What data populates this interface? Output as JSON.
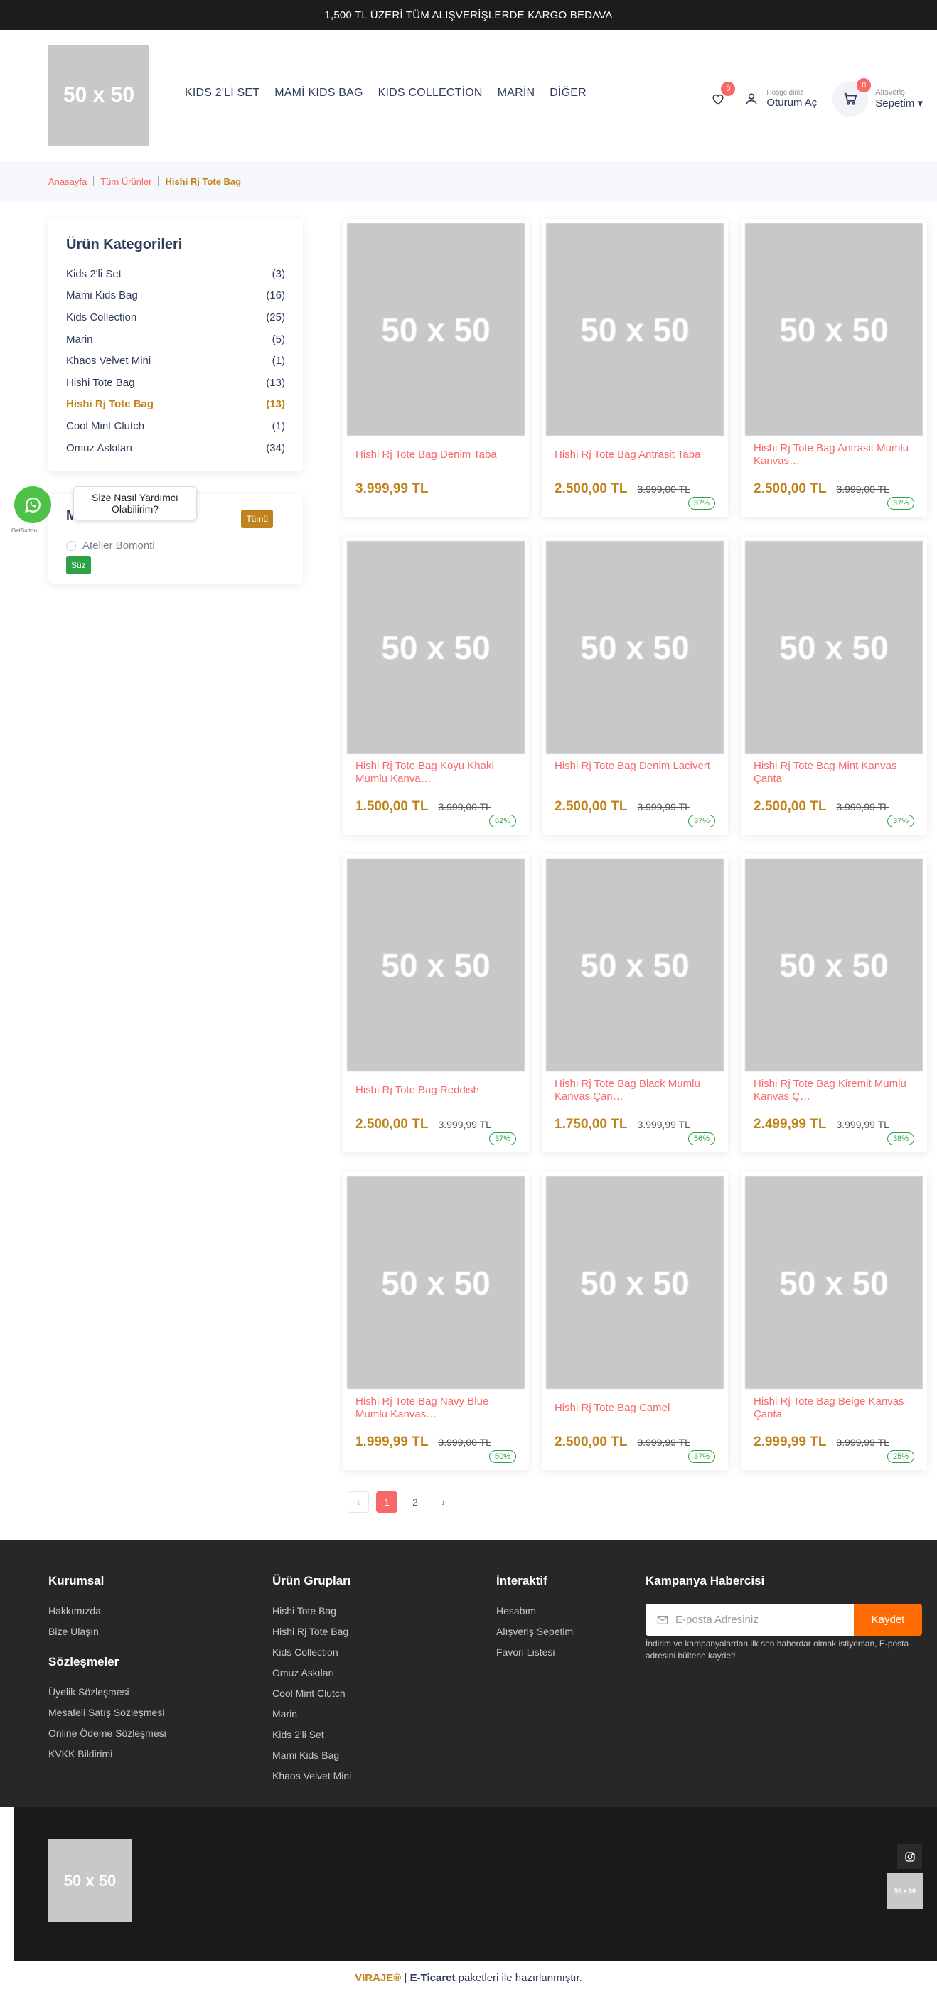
{
  "topbar": {
    "text": "1,500 TL ÜZERİ TÜM ALIŞVERİŞLERDE KARGO BEDAVA"
  },
  "header": {
    "logo": "50 x 50",
    "nav": [
      "KIDS 2'Lİ SET",
      "MAMİ KIDS BAG",
      "KIDS COLLECTİON",
      "MARİN",
      "DİĞER"
    ],
    "wishlist_count": "0",
    "account": {
      "greeting": "Hoşgeldiniz",
      "action": "Oturum Aç"
    },
    "cart": {
      "count": "0",
      "label_small": "Alışveriş",
      "label_big": "Sepetim ▾"
    }
  },
  "breadcrumb": {
    "items": [
      "Anasayfa",
      "Tüm Ürünler"
    ],
    "current": "Hishi Rj Tote Bag"
  },
  "sidebar": {
    "categories_title": "Ürün Kategorileri",
    "categories": [
      {
        "name": "Kids 2'li Set",
        "count": "(3)"
      },
      {
        "name": "Mami Kids Bag",
        "count": "(16)"
      },
      {
        "name": "Kids Collection",
        "count": "(25)"
      },
      {
        "name": "Marin",
        "count": "(5)"
      },
      {
        "name": "Khaos Velvet Mini",
        "count": "(1)"
      },
      {
        "name": "Hishi Tote Bag",
        "count": "(13)"
      },
      {
        "name": "Hishi Rj Tote Bag",
        "count": "(13)"
      },
      {
        "name": "Cool Mint Clutch",
        "count": "(1)"
      },
      {
        "name": "Omuz Askıları",
        "count": "(34)"
      }
    ],
    "brand_title": "Ma",
    "brand_all": "Tümü",
    "brand_option": "Atelier Bomonti",
    "filter_button": "Süz"
  },
  "whatsapp": {
    "tooltip": "Size Nasıl Yardımcı Olabilirim?",
    "getbutton": "GetButton"
  },
  "products": [
    {
      "img": "50 x 50",
      "name": "Hishi Rj Tote Bag Denim Taba",
      "price": "3.999,99 TL",
      "old": "",
      "discount": ""
    },
    {
      "img": "50 x 50",
      "name": "Hishi Rj Tote Bag Antrasit Taba",
      "price": "2.500,00 TL",
      "old": "3.999,00 TL",
      "discount": "37%"
    },
    {
      "img": "50 x 50",
      "name": "Hishi Rj Tote Bag Antrasit Mumlu Kanvas…",
      "price": "2.500,00 TL",
      "old": "3.999,00 TL",
      "discount": "37%"
    },
    {
      "img": "50 x 50",
      "name": "Hishi Rj Tote Bag Koyu Khaki Mumlu Kanva…",
      "price": "1.500,00 TL",
      "old": "3.999,00 TL",
      "discount": "62%"
    },
    {
      "img": "50 x 50",
      "name": "Hishi Rj Tote Bag Denim Lacivert",
      "price": "2.500,00 TL",
      "old": "3.999,99 TL",
      "discount": "37%"
    },
    {
      "img": "50 x 50",
      "name": "Hishi Rj Tote Bag Mint Kanvas Çanta",
      "price": "2.500,00 TL",
      "old": "3.999,99 TL",
      "discount": "37%"
    },
    {
      "img": "50 x 50",
      "name": "Hishi Rj Tote Bag Reddish",
      "price": "2.500,00 TL",
      "old": "3.999,99 TL",
      "discount": "37%"
    },
    {
      "img": "50 x 50",
      "name": "Hishi Rj Tote Bag Black Mumlu Kanvas Çan…",
      "price": "1.750,00 TL",
      "old": "3.999,99 TL",
      "discount": "56%"
    },
    {
      "img": "50 x 50",
      "name": "Hishi Rj Tote Bag Kiremit Mumlu Kanvas Ç…",
      "price": "2.499,99 TL",
      "old": "3.999,99 TL",
      "discount": "38%"
    },
    {
      "img": "50 x 50",
      "name": "Hishi Rj Tote Bag Navy Blue Mumlu Kanvas…",
      "price": "1.999,99 TL",
      "old": "3.999,00 TL",
      "discount": "50%"
    },
    {
      "img": "50 x 50",
      "name": "Hishi Rj Tote Bag Camel",
      "price": "2.500,00 TL",
      "old": "3.999,99 TL",
      "discount": "37%"
    },
    {
      "img": "50 x 50",
      "name": "Hishi Rj Tote Bag Beige Kanvas Çanta",
      "price": "2.999,99 TL",
      "old": "3.999,99 TL",
      "discount": "25%"
    }
  ],
  "pagination": {
    "prev": "‹",
    "pages": [
      "1",
      "2"
    ],
    "next": "›"
  },
  "footer": {
    "kurumsal": {
      "title": "Kurumsal",
      "links": [
        "Hakkımızda",
        "Bize Ulaşın"
      ]
    },
    "sozlesmeler": {
      "title": "Sözleşmeler",
      "links": [
        "Üyelik Sözleşmesi",
        "Mesafeli Satış Sözleşmesi",
        "Online Ödeme Sözleşmesi",
        "KVKK Bildirimi"
      ]
    },
    "urun_gruplari": {
      "title": "Ürün Grupları",
      "links": [
        "Hishi Tote Bag",
        "Hishi Rj Tote Bag",
        "Kids Collection",
        "Omuz Askıları",
        "Cool Mint Clutch",
        "Marin",
        "Kids 2'li Set",
        "Mami Kids Bag",
        "Khaos Velvet Mini"
      ]
    },
    "interaktif": {
      "title": "İnteraktif",
      "links": [
        "Hesabım",
        "Alışveriş Sepetim",
        "Favori Listesi"
      ]
    },
    "newsletter": {
      "title": "Kampanya Habercisi",
      "placeholder": "E-posta Adresiniz",
      "button": "Kaydet",
      "note": "İndirim ve kampanyalardan ilk sen haberdar olmak istiyorsan, E-posta adresini bültene kaydet!"
    }
  },
  "bottom": {
    "logo": "50 x 50",
    "small_logo": "50 x 50"
  },
  "credit": {
    "brand": "VIRAJE®",
    "sep": " | ",
    "product": "E-Ticaret",
    "rest": " paketleri ile hazırlanmıştır."
  }
}
